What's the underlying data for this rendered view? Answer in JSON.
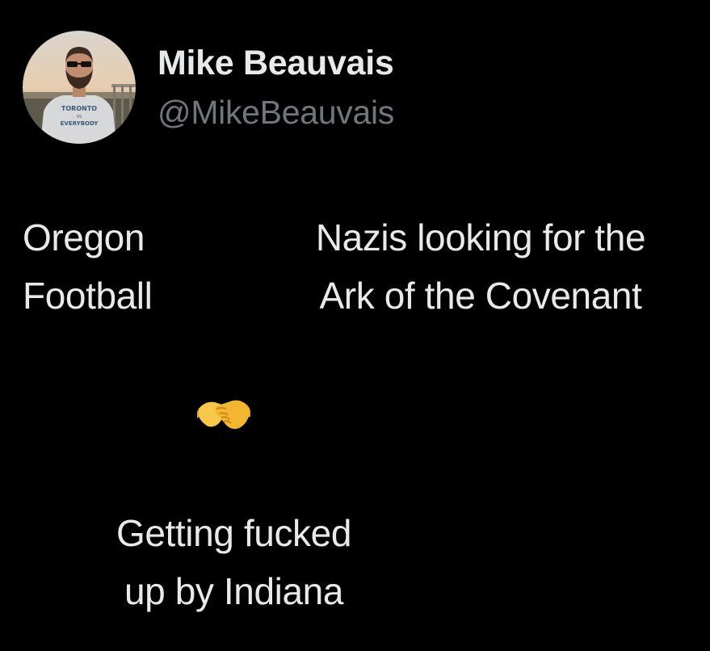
{
  "author": {
    "display_name": "Mike Beauvais",
    "handle": "@MikeBeauvais",
    "avatar_icon": "profile-photo",
    "shirt_text_top": "TORONTO",
    "shirt_text_mid": "VS",
    "shirt_text_bottom": "EVERYBODY"
  },
  "tweet": {
    "left_lines": [
      "Oregon",
      "Football"
    ],
    "right_lines": [
      "Nazis looking for the",
      "Ark of the Covenant"
    ],
    "emoji": "handshake-emoji",
    "bottom_lines": [
      "Getting fucked",
      "up by Indiana"
    ]
  },
  "colors": {
    "background": "#000000",
    "primary_text": "#e7e9ea",
    "secondary_text": "#71767b",
    "emoji_yellow": "#f7c948"
  }
}
